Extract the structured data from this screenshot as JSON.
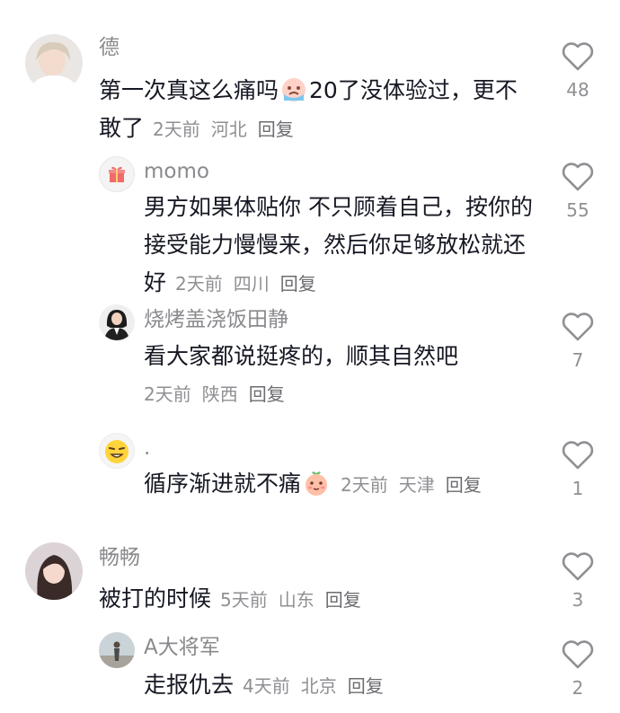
{
  "comments": [
    {
      "username": "德",
      "text_part1": "第一次真这么痛吗",
      "emoji": "crying-face-emoji",
      "text_part2": "20了没体验过，更不敢了",
      "time": "2天前",
      "location": "河北",
      "reply_label": "回复",
      "likes": "48"
    },
    {
      "username": "momo",
      "text": "男方如果体贴你 不只顾着自己，按你的接受能力慢慢来，然后你足够放松就还好",
      "time": "2天前",
      "location": "四川",
      "reply_label": "回复",
      "likes": "55"
    },
    {
      "username": "烧烤盖浇饭田静",
      "text": "看大家都说挺疼的，顺其自然吧",
      "time": "2天前",
      "location": "陕西",
      "reply_label": "回复",
      "likes": "7"
    },
    {
      "username": ".",
      "text": "循序渐进就不痛",
      "emoji": "peach-shy-emoji",
      "time": "2天前",
      "location": "天津",
      "reply_label": "回复",
      "likes": "1"
    },
    {
      "username": "畅畅",
      "text": "被打的时候",
      "time": "5天前",
      "location": "山东",
      "reply_label": "回复",
      "likes": "3"
    },
    {
      "username": "A大将军",
      "text": "走报仇去",
      "time": "4天前",
      "location": "北京",
      "reply_label": "回复",
      "likes": "2"
    }
  ],
  "colors": {
    "username": "#8a8a8e",
    "text": "#161823",
    "meta": "#8f8f94",
    "heart_outline": "#8f8f94"
  }
}
